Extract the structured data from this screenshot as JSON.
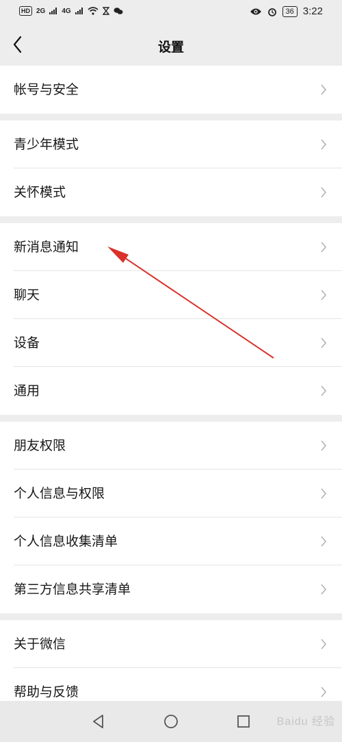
{
  "status_bar": {
    "left_badge": "HD",
    "network_1": "2G",
    "network_2": "4G",
    "battery": "36",
    "time": "3:22"
  },
  "header": {
    "title": "设置"
  },
  "groups": [
    {
      "items": [
        {
          "label": "帐号与安全"
        }
      ]
    },
    {
      "items": [
        {
          "label": "青少年模式"
        },
        {
          "label": "关怀模式"
        }
      ]
    },
    {
      "items": [
        {
          "label": "新消息通知"
        },
        {
          "label": "聊天"
        },
        {
          "label": "设备"
        },
        {
          "label": "通用"
        }
      ]
    },
    {
      "items": [
        {
          "label": "朋友权限"
        },
        {
          "label": "个人信息与权限"
        },
        {
          "label": "个人信息收集清单"
        },
        {
          "label": "第三方信息共享清单"
        }
      ]
    },
    {
      "items": [
        {
          "label": "关于微信"
        },
        {
          "label": "帮助与反馈"
        }
      ]
    }
  ],
  "watermark": "Baidu 经验",
  "colors": {
    "background": "#ededed",
    "row": "#ffffff",
    "annotation_arrow": "#d9322a"
  }
}
